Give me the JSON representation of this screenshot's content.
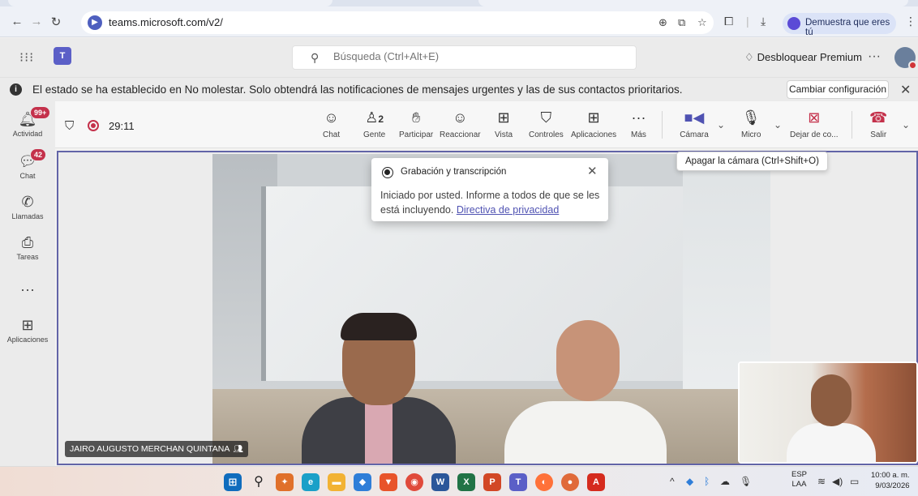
{
  "browser": {
    "url": "teams.microsoft.com/v2/",
    "profile_label": "Demuestra que eres tú"
  },
  "teams": {
    "search_placeholder": "Búsqueda (Ctrl+Alt+E)",
    "premium_label": "Desbloquear Premium",
    "more_label": "···"
  },
  "banner": {
    "text": "El estado se ha establecido en No molestar. Solo obtendrá las notificaciones de mensajes urgentes y las de sus contactos prioritarios.",
    "button_label": "Cambiar configuración"
  },
  "rail": {
    "items": [
      {
        "label": "Actividad",
        "icon": "bell-icon",
        "badge": "99+"
      },
      {
        "label": "Chat",
        "icon": "chat-icon",
        "badge": "42"
      },
      {
        "label": "Llamadas",
        "icon": "phone-icon",
        "badge": ""
      },
      {
        "label": "Tareas",
        "icon": "tasks-icon",
        "badge": ""
      },
      {
        "label": "",
        "icon": "more-icon",
        "badge": ""
      },
      {
        "label": "Aplicaciones",
        "icon": "add-apps-icon",
        "badge": ""
      }
    ]
  },
  "meeting": {
    "timer": "29:11",
    "people_count": "2",
    "toolbar": [
      {
        "label": "Chat",
        "icon": "chat-icon"
      },
      {
        "label": "Gente",
        "icon": "people-icon"
      },
      {
        "label": "Participar",
        "icon": "raise-hand-icon"
      },
      {
        "label": "Reaccionar",
        "icon": "smile-icon"
      },
      {
        "label": "Vista",
        "icon": "grid-view-icon"
      },
      {
        "label": "Controles",
        "icon": "shield-controls-icon"
      },
      {
        "label": "Aplicaciones",
        "icon": "add-icon"
      },
      {
        "label": "Más",
        "icon": "more-icon"
      },
      {
        "label": "Cámara",
        "icon": "camera-icon"
      },
      {
        "label": "Micro",
        "icon": "microphone-icon"
      },
      {
        "label": "Dejar de co...",
        "icon": "stop-share-icon"
      },
      {
        "label": "Salir",
        "icon": "leave-call-icon"
      }
    ],
    "tooltip": "Apagar la cámara (Ctrl+Shift+O)",
    "participant_name": "JAIRO AUGUSTO MERCHAN QUINTANA"
  },
  "recording_popup": {
    "title": "Grabación y transcripción",
    "body": "Iniciado por usted. Informe a todos de que se les está incluyendo.",
    "link": "Directiva de privacidad"
  },
  "taskbar": {
    "lang_top": "ESP",
    "lang_bottom": "LAA",
    "time": "10:00 a. m.",
    "date": "9/03/2026"
  },
  "colors": {
    "teams_purple": "#5b5fc7",
    "recording_red": "#c4314b",
    "stage_border": "#6264a7"
  }
}
